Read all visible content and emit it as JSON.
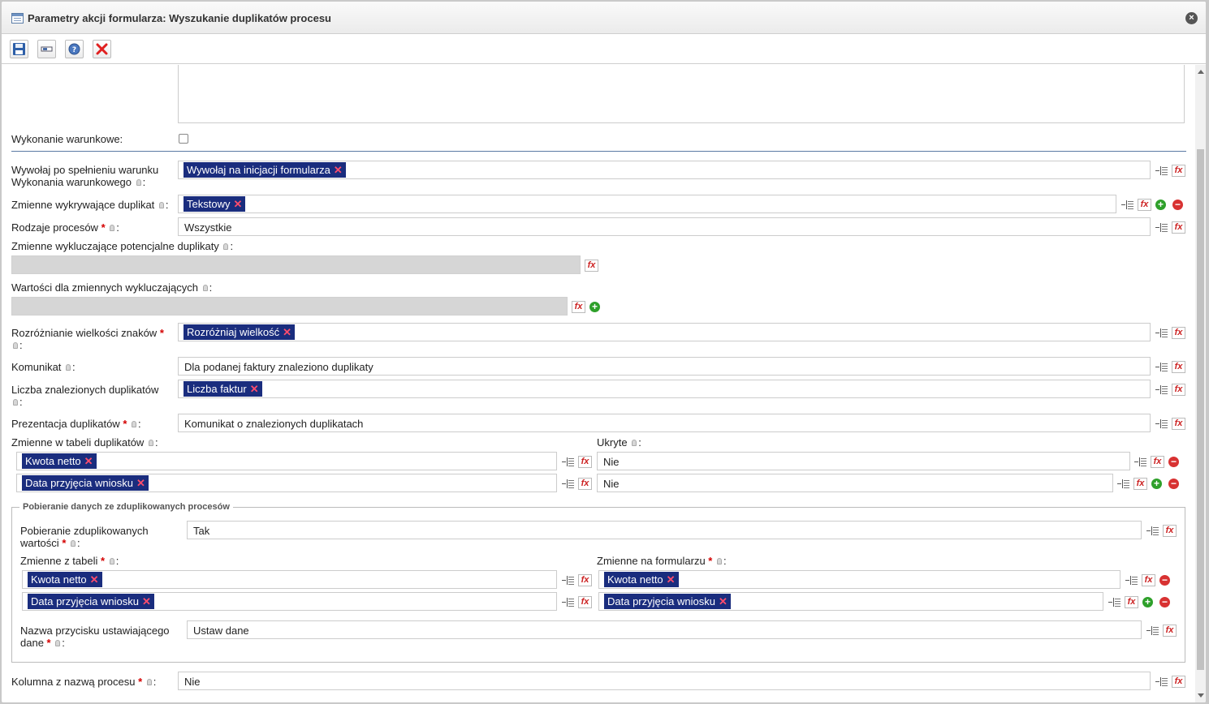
{
  "window": {
    "title": "Parametry akcji formularza: Wyszukanie duplikatów procesu",
    "close_label": "×",
    "icon": "table-icon"
  },
  "toolbar": {
    "buttons": [
      {
        "name": "save-button",
        "icon": "floppy-disk-icon"
      },
      {
        "name": "field-button",
        "icon": "textbox-icon"
      },
      {
        "name": "help-button",
        "icon": "question-icon"
      },
      {
        "name": "cancel-button",
        "icon": "red-x-icon"
      }
    ]
  },
  "icons": {
    "list": "map-list-icon",
    "fx": "function-icon",
    "add": "plus-circle-icon",
    "remove": "minus-circle-icon",
    "hint": "bulb-icon"
  },
  "symbols": {
    "fx": "fx",
    "plus": "+",
    "minus": "−",
    "x": "✕"
  },
  "colors": {
    "tag_bg": "#1a2d7e",
    "tag_remove": "#ff4d6d",
    "required": "#d40000",
    "add": "#2ea02a",
    "remove": "#d83232"
  },
  "form": {
    "conditional_label": "Wykonanie warunkowe:",
    "conditional_checked": false,
    "call_label_1": "Wywołaj po spełnieniu warunku",
    "call_label_2": "Wykonania warunkowego",
    "call_tag": "Wywołaj na inicjacji formularza",
    "detect_label": "Zmienne wykrywające duplikat",
    "detect_tag": "Tekstowy",
    "types_label": "Rodzaje procesów",
    "types_value": "Wszystkie",
    "excl_label": "Zmienne wykluczające potencjalne duplikaty",
    "excl_values_label": "Wartości dla zmiennych wykluczających",
    "case_label": "Rozróżnianie wielkości znaków",
    "case_tag": "Rozróżniaj wielkość",
    "msg_label": "Komunikat",
    "msg_value": "Dla podanej faktury znaleziono duplikaty",
    "count_label": "Liczba znalezionych duplikatów",
    "count_tag": "Liczba faktur",
    "pres_label": "Prezentacja duplikatów",
    "pres_value": "Komunikat o znalezionych duplikatach",
    "tablevars_label": "Zmienne w tabeli duplikatów",
    "hidden_label": "Ukryte",
    "tablevars": [
      {
        "tag": "Kwota netto",
        "hidden": "Nie"
      },
      {
        "tag": "Data przyjęcia wniosku",
        "hidden": "Nie"
      }
    ],
    "colname_label": "Kolumna z nazwą procesu",
    "colname_value": "Nie"
  },
  "fetch": {
    "legend": "Pobieranie danych ze zduplikowanych procesów",
    "label_1": "Pobieranie zduplikowanych",
    "label_2": "wartości",
    "value": "Tak",
    "from_label": "Zmienne z tabeli",
    "to_label": "Zmienne na formularzu",
    "rows": [
      {
        "from": "Kwota netto",
        "to": "Kwota netto"
      },
      {
        "from": "Data przyjęcia wniosku",
        "to": "Data przyjęcia wniosku"
      }
    ],
    "btn_label_1": "Nazwa przycisku ustawiającego",
    "btn_label_2": "dane",
    "btn_value": "Ustaw dane"
  }
}
